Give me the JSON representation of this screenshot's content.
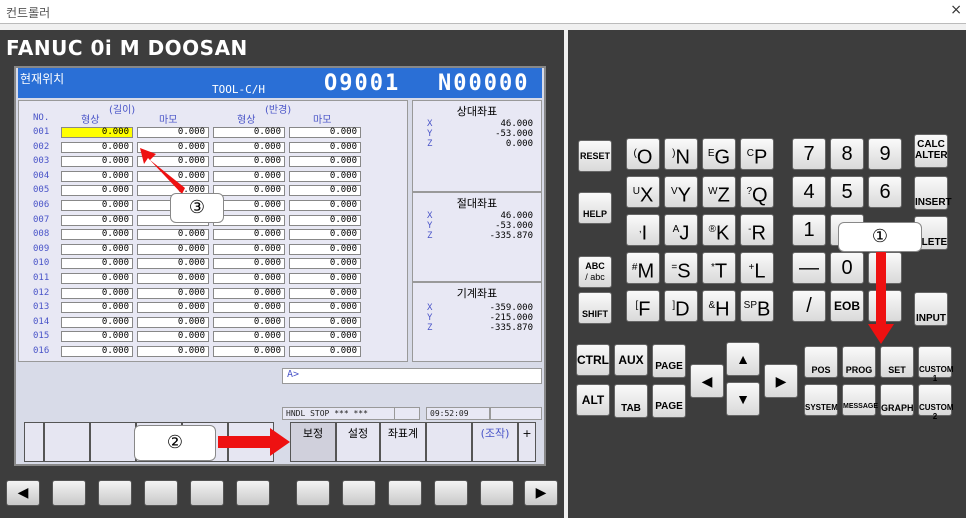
{
  "window": {
    "title": "컨트롤러",
    "close": "×"
  },
  "brand": "FANUC 0i M DOOSAN",
  "screen": {
    "title": "현재위치",
    "tool_label": "TOOL-C/H",
    "program": "O9001",
    "sequence": "N00000"
  },
  "offset_table": {
    "no_header": "NO.",
    "group_length": "(길이)",
    "group_radius": "(반경)",
    "col_shape": "형상",
    "col_wear": "마모",
    "rows": [
      {
        "no": "001",
        "v1": "0.000",
        "v2": "0.000",
        "v3": "0.000",
        "v4": "0.000"
      },
      {
        "no": "002",
        "v1": "0.000",
        "v2": "0.000",
        "v3": "0.000",
        "v4": "0.000"
      },
      {
        "no": "003",
        "v1": "0.000",
        "v2": "0.000",
        "v3": "0.000",
        "v4": "0.000"
      },
      {
        "no": "004",
        "v1": "0.000",
        "v2": "0.000",
        "v3": "0.000",
        "v4": "0.000"
      },
      {
        "no": "005",
        "v1": "0.000",
        "v2": "0.000",
        "v3": "0.000",
        "v4": "0.000"
      },
      {
        "no": "006",
        "v1": "0.000",
        "v2": "0.000",
        "v3": "0.000",
        "v4": "0.000"
      },
      {
        "no": "007",
        "v1": "0.000",
        "v2": "0.000",
        "v3": "0.000",
        "v4": "0.000"
      },
      {
        "no": "008",
        "v1": "0.000",
        "v2": "0.000",
        "v3": "0.000",
        "v4": "0.000"
      },
      {
        "no": "009",
        "v1": "0.000",
        "v2": "0.000",
        "v3": "0.000",
        "v4": "0.000"
      },
      {
        "no": "010",
        "v1": "0.000",
        "v2": "0.000",
        "v3": "0.000",
        "v4": "0.000"
      },
      {
        "no": "011",
        "v1": "0.000",
        "v2": "0.000",
        "v3": "0.000",
        "v4": "0.000"
      },
      {
        "no": "012",
        "v1": "0.000",
        "v2": "0.000",
        "v3": "0.000",
        "v4": "0.000"
      },
      {
        "no": "013",
        "v1": "0.000",
        "v2": "0.000",
        "v3": "0.000",
        "v4": "0.000"
      },
      {
        "no": "014",
        "v1": "0.000",
        "v2": "0.000",
        "v3": "0.000",
        "v4": "0.000"
      },
      {
        "no": "015",
        "v1": "0.000",
        "v2": "0.000",
        "v3": "0.000",
        "v4": "0.000"
      },
      {
        "no": "016",
        "v1": "0.000",
        "v2": "0.000",
        "v3": "0.000",
        "v4": "0.000"
      }
    ]
  },
  "coords": {
    "relative": {
      "title": "상대좌표",
      "x": "46.000",
      "y": "-53.000",
      "z": "0.000"
    },
    "absolute": {
      "title": "절대좌표",
      "x": "46.000",
      "y": "-53.000",
      "z": "-335.870"
    },
    "machine": {
      "title": "기계좌표",
      "x": "-359.000",
      "y": "-215.000",
      "z": "-335.870"
    },
    "ax_x": "X",
    "ax_y": "Y",
    "ax_z": "Z"
  },
  "cmd_prompt": "A>",
  "status": {
    "mode": "HNDL",
    "state": "STOP",
    "f1": "***",
    "f2": "***",
    "time": "09:52:09"
  },
  "softkeys": [
    "보정",
    "설정",
    "좌표계",
    "(조작)",
    "+"
  ],
  "annotations": {
    "one": "①",
    "two": "②",
    "three": "③"
  },
  "keypad": {
    "reset": "RESET",
    "help": "HELP",
    "abc": "ABC",
    "abc_sub": "/ abc",
    "shift": "SHIFT",
    "r1": [
      {
        "s": "(",
        "m": "O"
      },
      {
        "s": ")",
        "m": "N"
      },
      {
        "s": "E",
        "m": "G"
      },
      {
        "s": "C",
        "m": "P"
      }
    ],
    "r2": [
      {
        "s": "U",
        "m": "X"
      },
      {
        "s": "V",
        "m": "Y"
      },
      {
        "s": "W",
        "m": "Z"
      },
      {
        "s": "?",
        "m": "Q"
      }
    ],
    "r3": [
      {
        "s": ",",
        "m": "I"
      },
      {
        "s": "A",
        "m": "J"
      },
      {
        "s": "®",
        "m": "K"
      },
      {
        "s": "-",
        "m": "R"
      }
    ],
    "r4": [
      {
        "s": "#",
        "m": "M"
      },
      {
        "s": "=",
        "m": "S"
      },
      {
        "s": "*",
        "m": "T"
      },
      {
        "s": "+",
        "m": "L"
      }
    ],
    "r5": [
      {
        "s": "[",
        "m": "F"
      },
      {
        "s": "]",
        "m": "D"
      },
      {
        "s": "&",
        "m": "H"
      },
      {
        "s": "SP",
        "m": "B"
      }
    ],
    "n1": [
      "7",
      "8",
      "9"
    ],
    "n2": [
      "4",
      "5",
      "6"
    ],
    "n3": [
      "1",
      "",
      ""
    ],
    "n4": [
      "—",
      "0",
      ""
    ],
    "n5": [
      "/",
      "EOB",
      ""
    ],
    "calc": "CALC",
    "alter": "ALTER",
    "insert": "INSERT",
    "delete": "ELETE",
    "input": "INPUT",
    "ctrl": "CTRL",
    "aux": "AUX",
    "page": "PAGE",
    "alt": "ALT",
    "tab": "TAB",
    "pos": "POS",
    "prog": "PROG",
    "set": "SET",
    "custom1": "CUSTOM 1",
    "system": "SYSTEM",
    "message": "MESSAGE",
    "graph": "GRAPH",
    "custom2": "CUSTOM 2"
  },
  "bottom_nav": {
    "left": "◀",
    "right": "▶"
  },
  "colors": {
    "header": "#2a6fd6",
    "selected_cell": "#ffff00",
    "label_blue": "#4a55c8",
    "arrow_red": "#ee1111",
    "panel_bg": "#3d3d3d"
  }
}
